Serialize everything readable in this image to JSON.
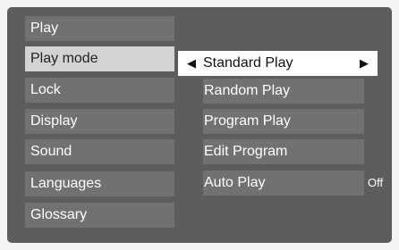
{
  "menu": {
    "categories": [
      {
        "label": "Play"
      },
      {
        "label": "Play mode"
      },
      {
        "label": "Lock"
      },
      {
        "label": "Display"
      },
      {
        "label": "Sound"
      },
      {
        "label": "Languages"
      },
      {
        "label": "Glossary"
      }
    ],
    "selected_category": "Play mode"
  },
  "play_mode": {
    "current_label": "Standard Play",
    "left_arrow_glyph": "◀",
    "right_arrow_glyph": "▶",
    "options": [
      {
        "label": "Random Play"
      },
      {
        "label": "Program Play"
      },
      {
        "label": "Edit Program"
      },
      {
        "label": "Auto Play",
        "value": "Off"
      }
    ]
  },
  "colors": {
    "panel_bg": "#5d5d5d",
    "item_bg": "#717171",
    "selected_bg": "#d3d3d3",
    "highlight_bg": "#ffffff",
    "text": "#ffffff"
  }
}
